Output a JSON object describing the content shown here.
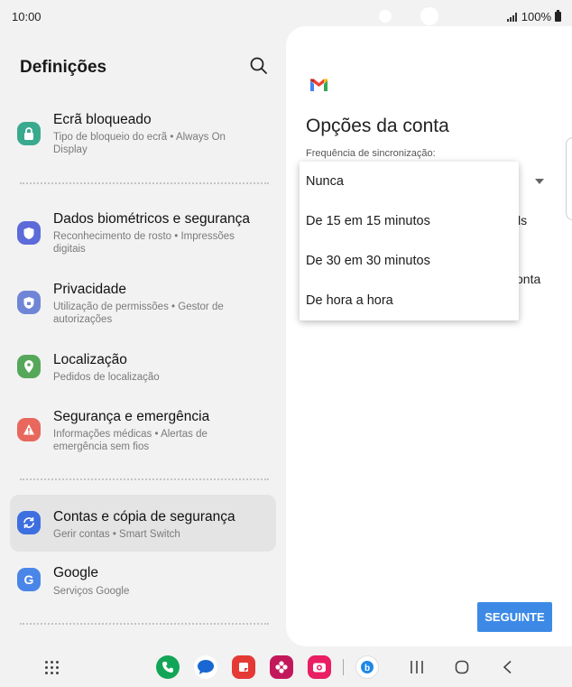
{
  "status": {
    "time": "10:00",
    "battery": "100%"
  },
  "settings": {
    "title": "Definições",
    "items": [
      {
        "title": "Ecrã bloqueado",
        "subtitle": "Tipo de bloqueio do ecrã  •  Always On Display",
        "icon": "lock-icon",
        "color": "#3aaa8f"
      },
      {
        "title": "Dados biométricos e segurança",
        "subtitle": "Reconhecimento de rosto  •  Impressões digitais",
        "icon": "shield-icon",
        "color": "#5c6bd8"
      },
      {
        "title": "Privacidade",
        "subtitle": "Utilização de permissões  •  Gestor de autorizações",
        "icon": "privacy-icon",
        "color": "#6f86d6"
      },
      {
        "title": "Localização",
        "subtitle": "Pedidos de localização",
        "icon": "location-pin-icon",
        "color": "#55a85a"
      },
      {
        "title": "Segurança e emergência",
        "subtitle": "Informações médicas  •  Alertas de emergência sem fios",
        "icon": "emergency-icon",
        "color": "#e8685e"
      },
      {
        "title": "Contas e cópia de segurança",
        "subtitle": "Gerir contas  •  Smart Switch",
        "icon": "sync-icon",
        "color": "#3d6fe0"
      },
      {
        "title": "Google",
        "subtitle": "Serviços Google",
        "icon": "google-icon",
        "color": "#4a86e8"
      }
    ]
  },
  "account": {
    "title": "Opções da conta",
    "frequency_label": "Frequência de sincronização:",
    "hidden_text_1": "ls",
    "hidden_text_2": "onta",
    "dropdown_options": [
      "Nunca",
      "De 15 em 15 minutos",
      "De 30 em 30 minutos",
      "De hora a hora"
    ],
    "next_label": "SEGUINTE"
  },
  "colors": {
    "accent": "#3c8ae6",
    "panel": "#ffffff",
    "background": "#f2f2f2"
  }
}
